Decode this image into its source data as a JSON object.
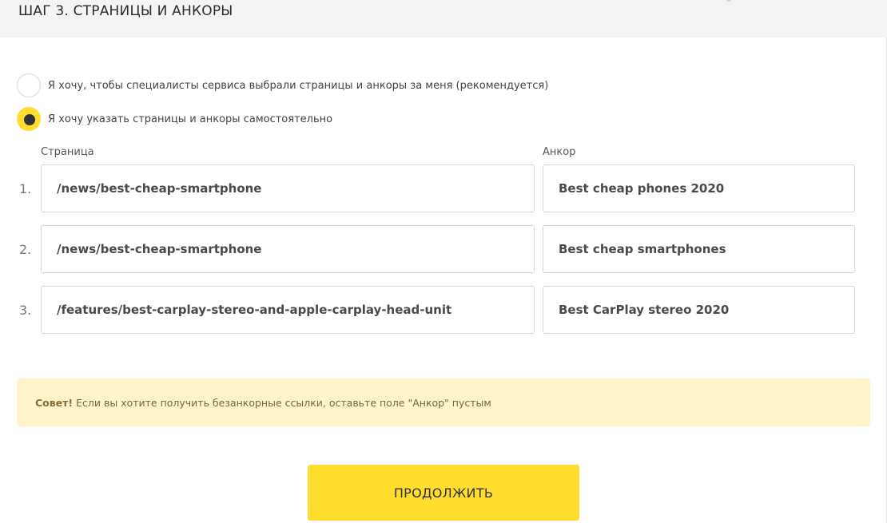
{
  "header": {
    "title": "ШАГ 3. СТРАНИЦЫ И АНКОРЫ"
  },
  "options": [
    {
      "label": "Я хочу, чтобы специалисты сервиса выбрали страницы и анкоры за меня (рекомендуется)",
      "selected": false
    },
    {
      "label": "Я хочу указать страницы и анкоры самостоятельно",
      "selected": true
    }
  ],
  "columns": {
    "page": "Страница",
    "anchor": "Анкор"
  },
  "rows": [
    {
      "num": "1.",
      "page": "/news/best-cheap-smartphone",
      "anchor": "Best cheap phones 2020"
    },
    {
      "num": "2.",
      "page": "/news/best-cheap-smartphone",
      "anchor": "Best cheap smartphones"
    },
    {
      "num": "3.",
      "page": "/features/best-carplay-stereo-and-apple-carplay-head-unit",
      "anchor": "Best CarPlay stereo 2020"
    }
  ],
  "tip": {
    "bold": "Совет!",
    "text": "Если вы хотите получить безанкорные ссылки, оставьте поле \"Анкор\" пустым"
  },
  "continue_label": "ПРОДОЛЖИТЬ",
  "colors": {
    "accent": "#ffdd2d",
    "tip_bg": "#fff3cc"
  }
}
